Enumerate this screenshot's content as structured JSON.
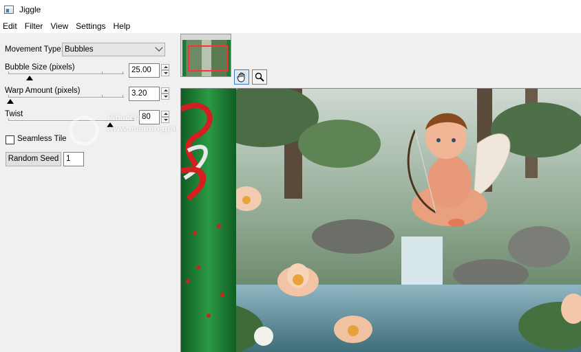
{
  "window": {
    "title": "Jiggle"
  },
  "menu": [
    "Edit",
    "Filter",
    "View",
    "Settings",
    "Help"
  ],
  "controls": {
    "movement_type_label": "Movement Type:",
    "movement_type_value": "Bubbles",
    "bubble_size_label": "Bubble Size (pixels)",
    "bubble_size_value": "25.00",
    "warp_amount_label": "Warp Amount (pixels)",
    "warp_amount_value": "3.20",
    "twist_label": "Twist",
    "twist_value": "80",
    "seamless_tile_label": "Seamless Tile",
    "seamless_tile_checked": false,
    "random_seed_button": "Random Seed",
    "random_seed_value": "1"
  },
  "watermark": {
    "name": "Pinuccia",
    "url": "www.maildiregrafica.eu"
  },
  "icons": {
    "pan_tool": "hand-icon",
    "zoom_tool": "magnifier-icon",
    "app": "window-icon"
  },
  "colors": {
    "ribbon_green": "#1f7a3a",
    "ribbon_red": "#d21f1f",
    "selection_red": "#ff3030"
  }
}
